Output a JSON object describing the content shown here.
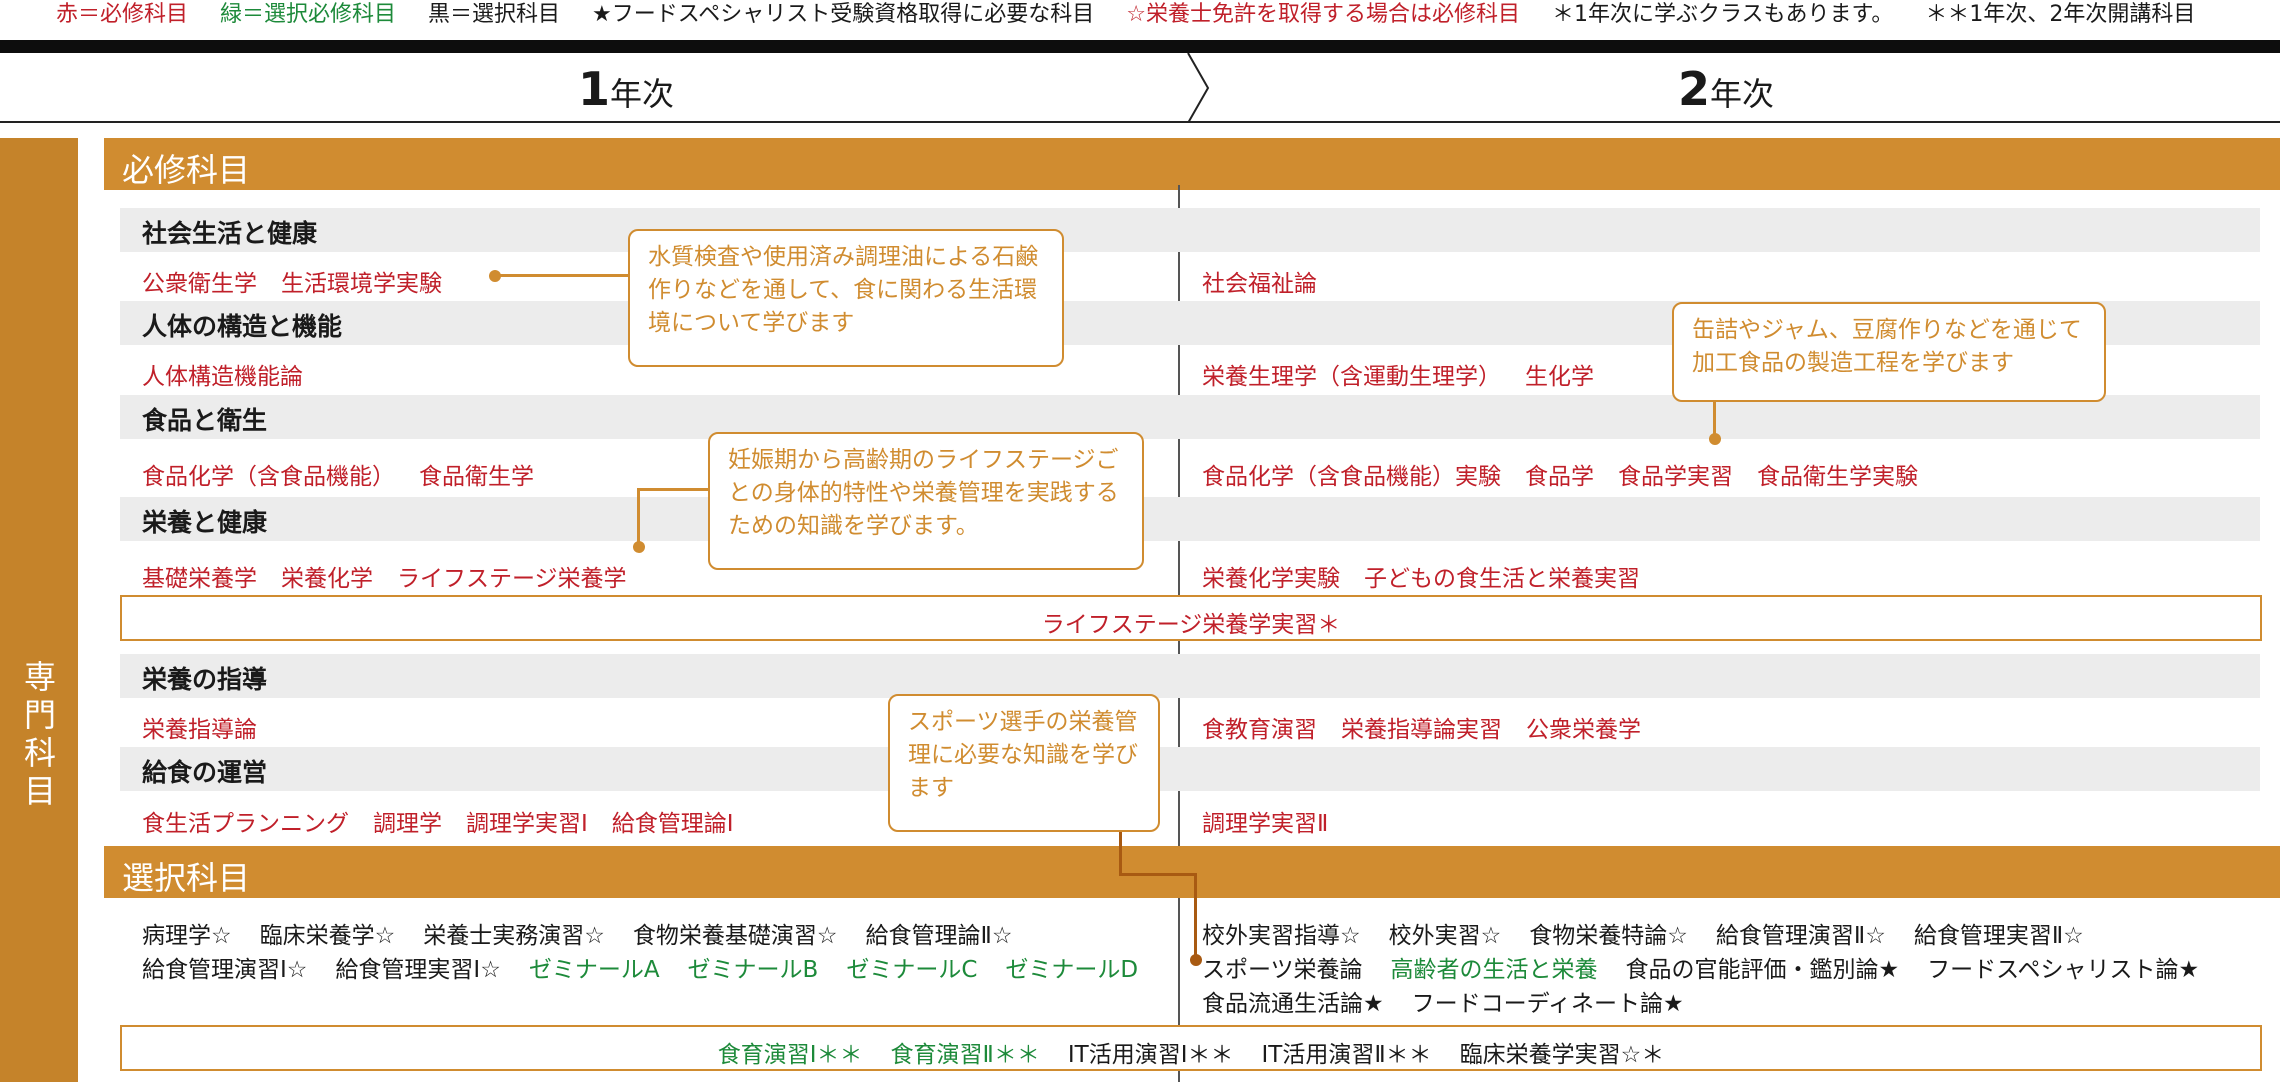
{
  "legend": {
    "red": "赤＝必修科目",
    "green": "緑＝選択必修科目",
    "black": "黒＝選択科目",
    "star": "★フードスペシャリスト受験資格取得に必要な科目",
    "whitestar": "☆栄養士免許を取得する場合は必修科目",
    "one_ast": "＊1年次に学ぶクラスもあります。",
    "two_ast": "＊＊1年次、2年次開講科目"
  },
  "years": {
    "y1_num": "1",
    "y1_suffix": "年次",
    "y2_num": "2",
    "y2_suffix": "年次"
  },
  "side_label": "専門科目",
  "required": {
    "header": "必修科目",
    "categories": [
      {
        "name": "社会生活と健康",
        "y1": [
          "公衆衛生学",
          "生活環境学実験"
        ],
        "y2": [
          "社会福祉論"
        ]
      },
      {
        "name": "人体の構造と機能",
        "y1": [
          "人体構造機能論"
        ],
        "y2": [
          "栄養生理学（含運動生理学）",
          "生化学"
        ]
      },
      {
        "name": "食品と衛生",
        "y1": [
          "食品化学（含食品機能）",
          "食品衛生学"
        ],
        "y2": [
          "食品化学（含食品機能）実験",
          "食品学",
          "食品学実習",
          "食品衛生学実験"
        ]
      },
      {
        "name": "栄養と健康",
        "y1": [
          "基礎栄養学",
          "栄養化学",
          "ライフステージ栄養学"
        ],
        "y2": [
          "栄養化学実験",
          "子どもの食生活と栄養実習"
        ]
      },
      {
        "name": "栄養の指導",
        "y1": [
          "栄養指導論"
        ],
        "y2": [
          "食教育演習",
          "栄養指導論実習",
          "公衆栄養学"
        ]
      },
      {
        "name": "給食の運営",
        "y1": [
          "食生活プランニング",
          "調理学",
          "調理学実習Ⅰ",
          "給食管理論Ⅰ"
        ],
        "y2": [
          "調理学実習Ⅱ"
        ]
      }
    ],
    "spanning": "ライフステージ栄養学実習＊"
  },
  "elective": {
    "header": "選択科目",
    "y1_row1": [
      {
        "t": "病理学☆",
        "c": "black"
      },
      {
        "t": "臨床栄養学☆",
        "c": "black"
      },
      {
        "t": "栄養士実務演習☆",
        "c": "black"
      },
      {
        "t": "食物栄養基礎演習☆",
        "c": "black"
      },
      {
        "t": "給食管理論Ⅱ☆",
        "c": "black"
      }
    ],
    "y1_row2": [
      {
        "t": "給食管理演習Ⅰ☆",
        "c": "black"
      },
      {
        "t": "給食管理実習Ⅰ☆",
        "c": "black"
      },
      {
        "t": "ゼミナールA",
        "c": "green"
      },
      {
        "t": "ゼミナールB",
        "c": "green"
      },
      {
        "t": "ゼミナールC",
        "c": "green"
      },
      {
        "t": "ゼミナールD",
        "c": "green"
      }
    ],
    "y2_row1": [
      {
        "t": "校外実習指導☆",
        "c": "black"
      },
      {
        "t": "校外実習☆",
        "c": "black"
      },
      {
        "t": "食物栄養特論☆",
        "c": "black"
      },
      {
        "t": "給食管理演習Ⅱ☆",
        "c": "black"
      },
      {
        "t": "給食管理実習Ⅱ☆",
        "c": "black"
      }
    ],
    "y2_row2": [
      {
        "t": "スポーツ栄養論",
        "c": "black"
      },
      {
        "t": "高齢者の生活と栄養",
        "c": "green"
      },
      {
        "t": "食品の官能評価・鑑別論★",
        "c": "black"
      },
      {
        "t": "フードスペシャリスト論★",
        "c": "black"
      }
    ],
    "y2_row3": [
      {
        "t": "食品流通生活論★",
        "c": "black"
      },
      {
        "t": "フードコーディネート論★",
        "c": "black"
      }
    ],
    "spanning": [
      {
        "t": "食育演習Ⅰ＊＊",
        "c": "green"
      },
      {
        "t": "食育演習Ⅱ＊＊",
        "c": "green"
      },
      {
        "t": "IT活用演習Ⅰ＊＊",
        "c": "black"
      },
      {
        "t": "IT活用演習Ⅱ＊＊",
        "c": "black"
      },
      {
        "t": "臨床栄養学実習☆＊",
        "c": "black"
      }
    ]
  },
  "callouts": {
    "water": "水質検査や使用済み調理油による石鹸作りなどを通して、食に関わる生活環境について学びます",
    "canned": "缶詰やジャム、豆腐作りなどを通じて加工食品の製造工程を学びます",
    "lifestage": "妊娠期から高齢期のライフステージごとの身体的特性や栄養管理を実践するための知識を学びます。",
    "sports": "スポーツ選手の栄養管理に必要な知識を学びます"
  },
  "colors": {
    "required_red": "#c0202a",
    "elective_green": "#1d8a3a",
    "accent_orange": "#d08c30",
    "side_bar": "#c5832a"
  }
}
